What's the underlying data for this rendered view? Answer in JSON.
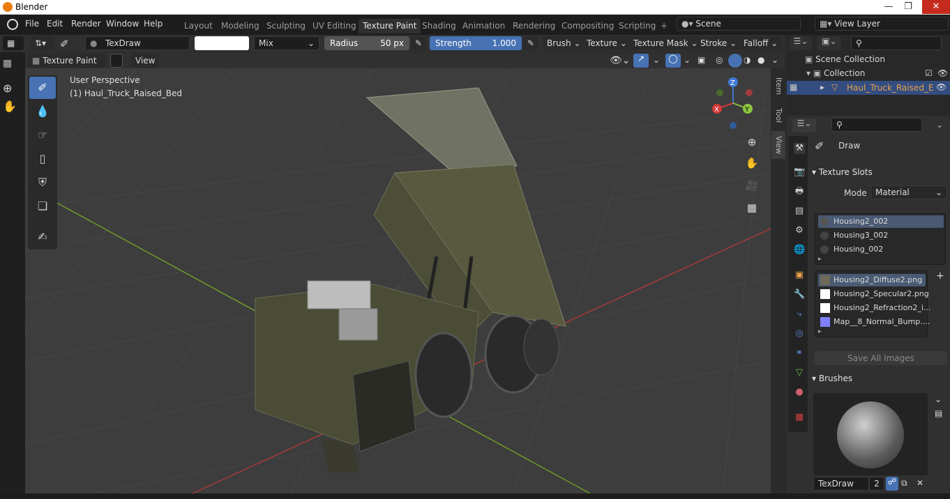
{
  "window": {
    "title": "Blender",
    "minimize": "—",
    "maximize": "❐",
    "close": "✕"
  },
  "menu": [
    "File",
    "Edit",
    "Render",
    "Window",
    "Help"
  ],
  "workspaces": [
    "Layout",
    "Modeling",
    "Sculpting",
    "UV Editing",
    "Texture Paint",
    "Shading",
    "Animation",
    "Rendering",
    "Compositing",
    "Scripting"
  ],
  "active_workspace": "Texture Paint",
  "scene": {
    "name": "Scene",
    "view_layer": "View Layer"
  },
  "tool_header": {
    "brush_name": "TexDraw",
    "blend": "Mix",
    "radius_label": "Radius",
    "radius_value": "50 px",
    "strength_label": "Strength",
    "strength_value": "1.000",
    "menus": [
      "Brush",
      "Texture",
      "Texture Mask",
      "Stroke",
      "Falloff"
    ],
    "brush_color": "#ffffff"
  },
  "viewport_header": {
    "mode": "Texture Paint",
    "view": "View"
  },
  "viewport": {
    "perspective": "User Perspective",
    "object_label": "(1) Haul_Truck_Raised_Bed",
    "gizmo": {
      "x": "X",
      "y": "Y",
      "z": "Z"
    }
  },
  "side_tabs": [
    "Item",
    "Tool",
    "View"
  ],
  "outliner": {
    "scene_collection": "Scene Collection",
    "collection": "Collection",
    "object": "Haul_Truck_Raised_E"
  },
  "properties": {
    "tool_name": "Draw",
    "texture_slots": {
      "title": "Texture Slots",
      "mode_label": "Mode",
      "mode_value": "Material",
      "materials": [
        "Housing2_002",
        "Housing3_002",
        "Housing_002"
      ],
      "images": [
        {
          "name": "Housing2_Diffuse2.png",
          "color": "#6f6a58"
        },
        {
          "name": "Housing2_Specular2.png",
          "color": "#ffffff"
        },
        {
          "name": "Housing2_Refraction2_i...",
          "color": "#ffffff"
        },
        {
          "name": "Map__8_Normal_Bump....",
          "color": "#8080ff"
        }
      ],
      "save_all": "Save All Images"
    },
    "brushes": {
      "title": "Brushes",
      "brush_name": "TexDraw",
      "users": "2"
    }
  },
  "colors": {
    "accent": "#4772b3",
    "selected_object": "#e8a24a",
    "x_axis": "#d43a3a",
    "y_axis": "#8cc63f",
    "z_axis": "#3f7ad4"
  }
}
